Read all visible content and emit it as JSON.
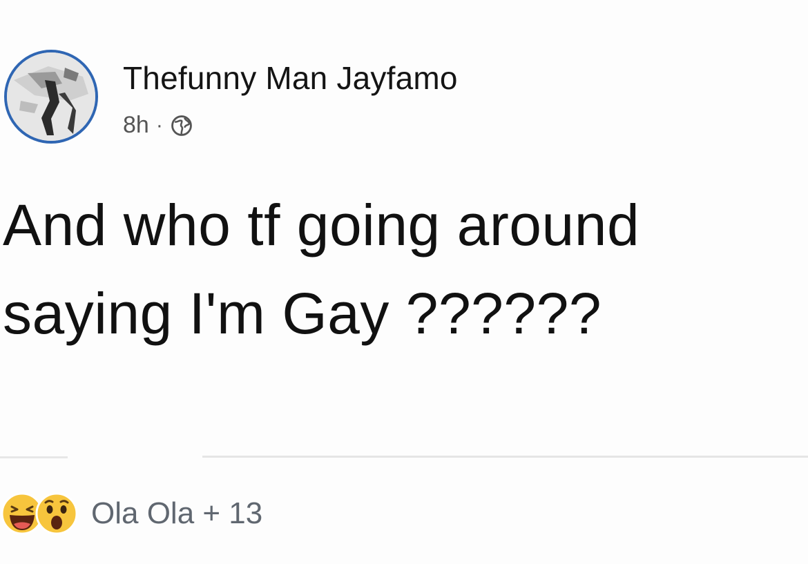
{
  "post": {
    "author": {
      "name": "Thefunny Man Jayfamo",
      "avatar_icon": "profile-photo",
      "avatar_ring_color": "#2f66b3"
    },
    "meta": {
      "time": "8h",
      "separator": "·",
      "audience_icon": "globe-icon"
    },
    "text_lines": [
      "And who tf going around",
      "saying I'm Gay ??????"
    ],
    "reactions": {
      "icons": [
        "haha-icon",
        "wow-icon"
      ],
      "summary": "Ola Ola + 13"
    }
  }
}
